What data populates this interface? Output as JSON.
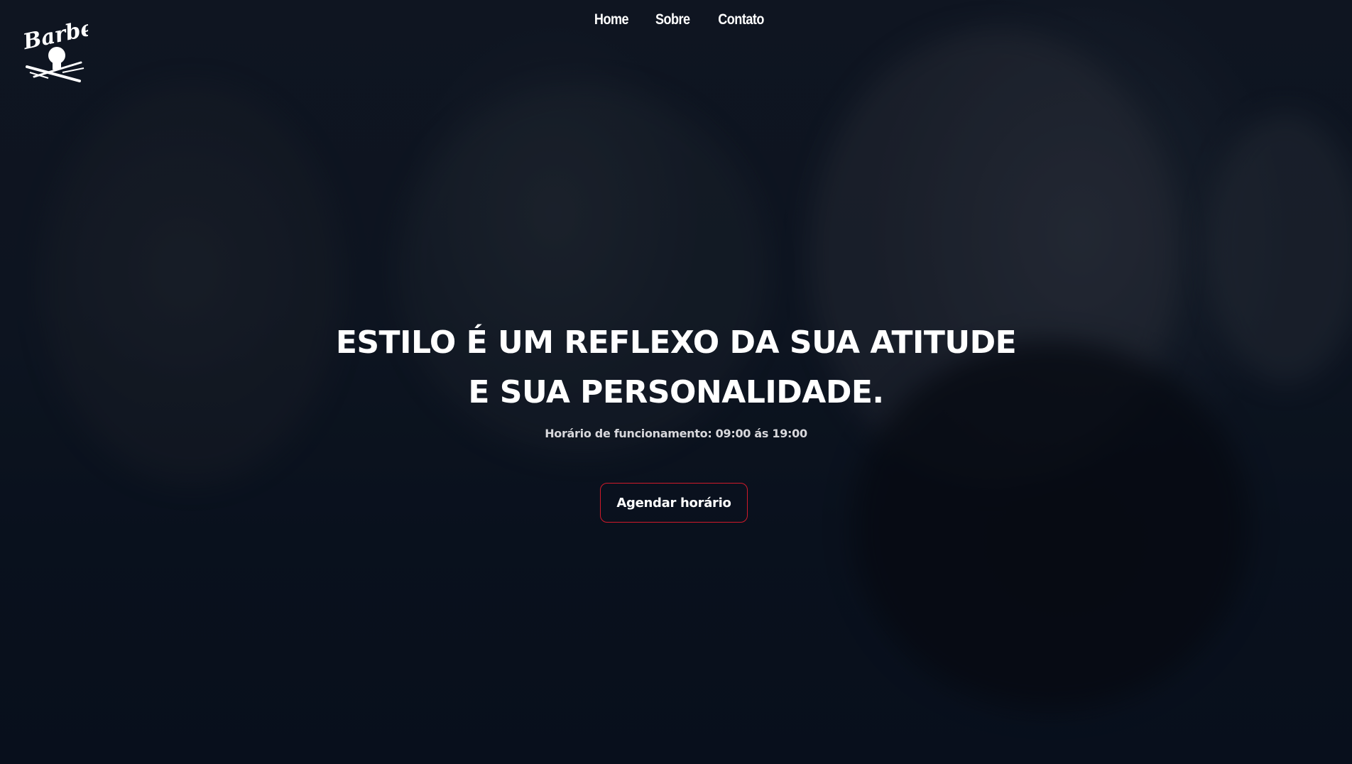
{
  "brand": {
    "logo_text": "Barber",
    "logo_icon": "barber-logo-icon"
  },
  "nav": {
    "items": [
      {
        "label": "Home"
      },
      {
        "label": "Sobre"
      },
      {
        "label": "Contato"
      }
    ]
  },
  "hero": {
    "headline": "ESTILO É UM REFLEXO DA SUA ATITUDE E SUA PERSONALIDADE.",
    "hours": "Horário de funcionamento: 09:00 ás 19:00",
    "cta_label": "Agendar horário",
    "background": "barbershop-photo"
  },
  "colors": {
    "background": "#0b1320",
    "text": "#ffffff",
    "accent_border": "#d11a2a",
    "subtext": "#d8d8dc"
  }
}
